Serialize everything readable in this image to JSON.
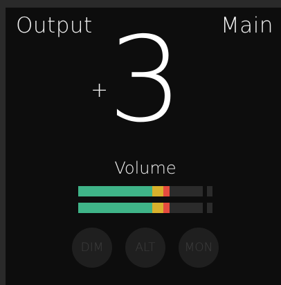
{
  "header": {
    "left_label": "Output",
    "right_label": "Main"
  },
  "volume": {
    "sign": "+",
    "value": "3",
    "label": "Volume"
  },
  "meters": [
    {
      "name": "left",
      "green": 0.59,
      "yellow": 0.09,
      "red": 0.05
    },
    {
      "name": "right",
      "green": 0.59,
      "yellow": 0.09,
      "red": 0.05
    }
  ],
  "buttons": {
    "dim": "DIM",
    "alt": "ALT",
    "mon": "MON"
  },
  "colors": {
    "background": "#0d0d0d",
    "meter_green": "#3fb488",
    "meter_yellow": "#d8b12c",
    "meter_red": "#e54b3f",
    "button_bg": "#1f1f1f"
  }
}
